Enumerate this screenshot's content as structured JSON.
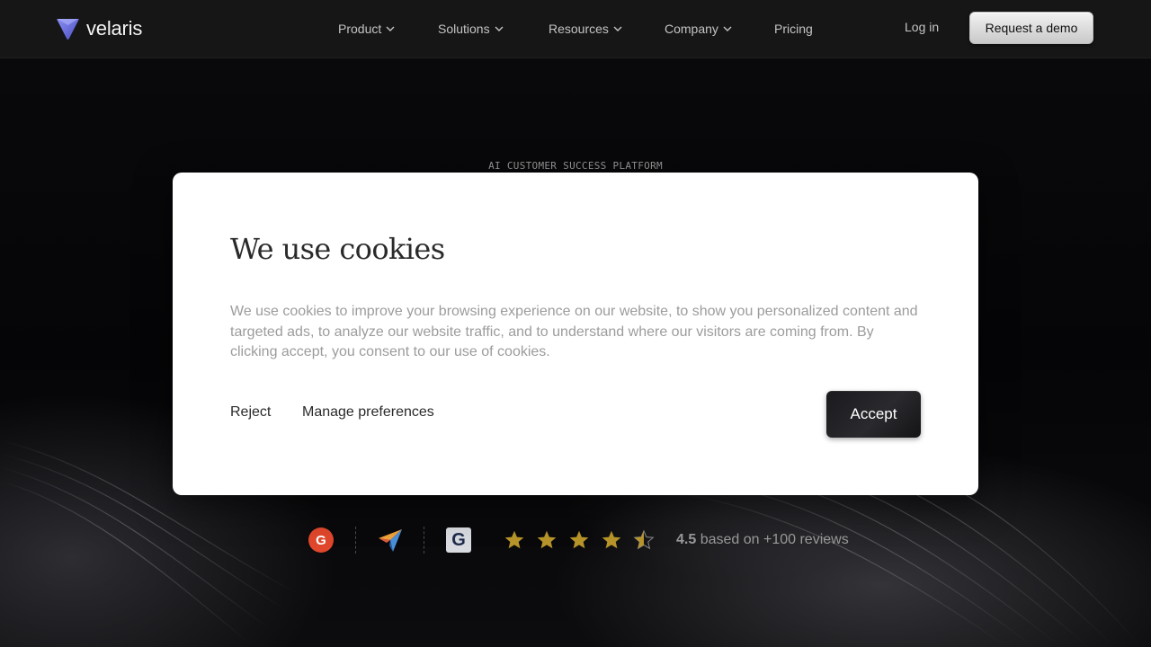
{
  "header": {
    "brand": "velaris",
    "nav": [
      {
        "label": "Product",
        "has_dropdown": true
      },
      {
        "label": "Solutions",
        "has_dropdown": true
      },
      {
        "label": "Resources",
        "has_dropdown": true
      },
      {
        "label": "Company",
        "has_dropdown": true
      },
      {
        "label": "Pricing",
        "has_dropdown": false
      }
    ],
    "login_label": "Log in",
    "demo_label": "Request a demo"
  },
  "hero": {
    "eyebrow": "AI CUSTOMER SUCCESS PLATFORM"
  },
  "cookie_modal": {
    "title": "We use cookies",
    "body": "We use cookies to improve your browsing experience on our website, to show you personalized content and targeted ads, to analyze our website traffic, and to understand where our visitors are coming from. By clicking accept, you consent to our use of cookies.",
    "reject_label": "Reject",
    "manage_label": "Manage preferences",
    "accept_label": "Accept"
  },
  "reviews": {
    "g2_text": "G",
    "getapp_text": "G",
    "rating": "4.5",
    "rating_value": 4.5,
    "max_rating": 5,
    "rating_suffix": "based on +100 reviews",
    "star_color": "#b8952a"
  },
  "colors": {
    "accent_logo": "#6a6fe0",
    "nav_bg": "#161616",
    "page_bg": "#050507"
  }
}
